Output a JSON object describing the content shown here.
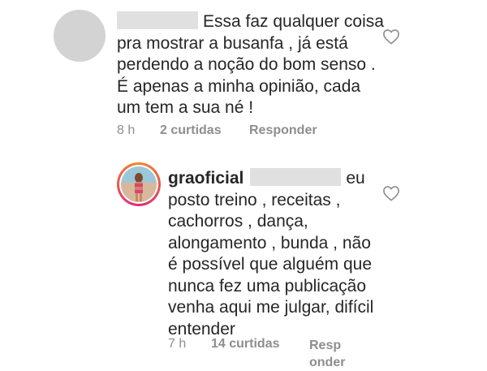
{
  "comment1": {
    "text": "Essa faz qualquer coisa pra mostrar a busanfa , já está perdendo a noção do bom senso . É apenas a minha opinião, cada um tem a sua né !",
    "time": "8 h",
    "likes": "2 curtidas",
    "reply": "Responder"
  },
  "reply1": {
    "username": "graoficial",
    "text": "eu posto treino , receitas , cachorros , dança, alongamento , bunda , não é possível que alguém que nunca fez uma publicação venha aqui me julgar, difícil entender",
    "time": "7 h",
    "likes": "14 curtidas",
    "reply_line1": "Resp",
    "reply_line2": "onder"
  },
  "icons": {
    "like": "heart-outline-icon"
  },
  "colors": {
    "text": "#262626",
    "meta": "#8e8e8e",
    "placeholder": "#d3d3d3",
    "redaction": "#e0e0e0"
  }
}
